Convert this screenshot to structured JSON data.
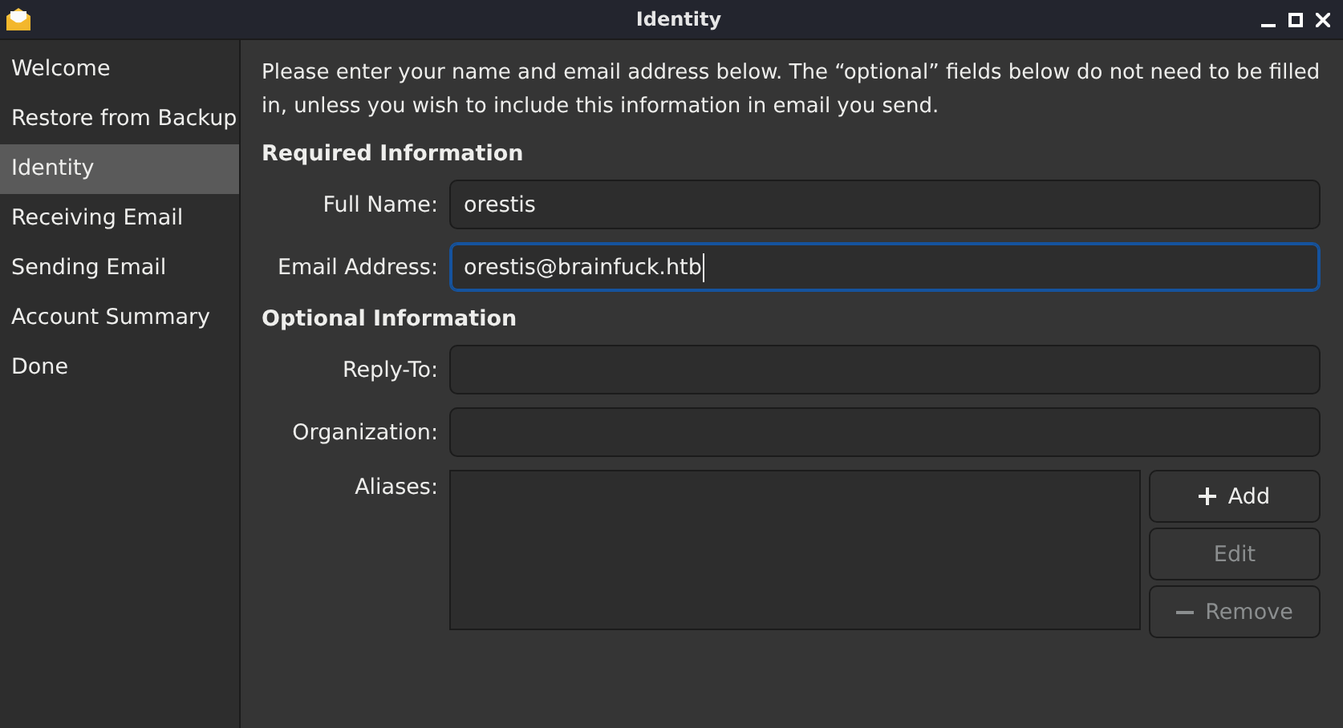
{
  "window": {
    "title": "Identity"
  },
  "sidebar": {
    "items": [
      {
        "label": "Welcome",
        "selected": false
      },
      {
        "label": "Restore from Backup",
        "selected": false
      },
      {
        "label": "Identity",
        "selected": true
      },
      {
        "label": "Receiving Email",
        "selected": false
      },
      {
        "label": "Sending Email",
        "selected": false
      },
      {
        "label": "Account Summary",
        "selected": false
      },
      {
        "label": "Done",
        "selected": false
      }
    ]
  },
  "intro": "Please enter your name and email address below. The “optional” fields below do not need to be filled in, unless you wish to include this information in email you send.",
  "sections": [
    {
      "heading": "Required Information",
      "fields": [
        {
          "kind": "text",
          "label": "Full Name:",
          "value": "orestis",
          "focused": false
        },
        {
          "kind": "text",
          "label": "Email Address:",
          "value": "orestis@brainfuck.htb",
          "focused": true
        }
      ]
    },
    {
      "heading": "Optional Information",
      "fields": [
        {
          "kind": "text",
          "label": "Reply-To:",
          "focused": false
        },
        {
          "kind": "text",
          "label": "Organization:",
          "focused": false
        },
        {
          "kind": "list",
          "label": "Aliases:",
          "buttons": [
            {
              "label": "Add",
              "kind": "plus",
              "disabled": false
            },
            {
              "label": "Edit",
              "disabled": true
            },
            {
              "label": "Remove",
              "kind": "minus",
              "disabled": true
            }
          ]
        }
      ]
    }
  ]
}
